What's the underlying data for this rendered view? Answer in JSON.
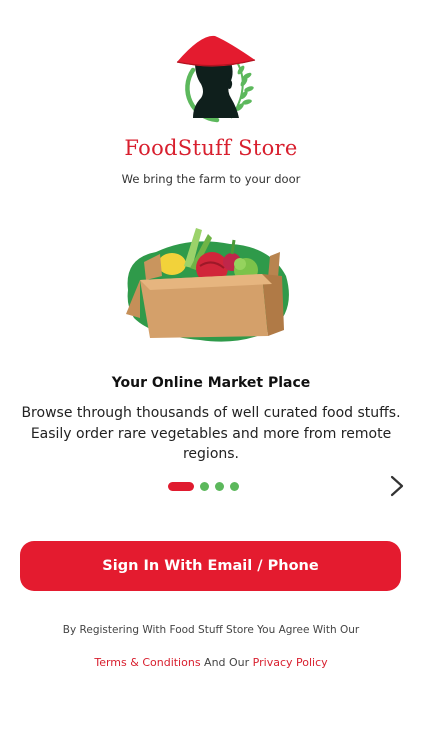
{
  "brand": {
    "name": "FoodStuff Store",
    "tagline": "We bring the farm to your door"
  },
  "slide": {
    "title": "Your Online Market Place",
    "description": "Browse through thousands of well curated food stuffs. Easily order rare vegetables and more from remote regions.",
    "current_index": 1,
    "total": 4
  },
  "actions": {
    "signin_label": "Sign In With Email / Phone"
  },
  "legal": {
    "notice": "By Registering With Food Stuff Store You Agree With Our",
    "terms_label": "Terms & Conditions",
    "connector": " And Our ",
    "privacy_label": "Privacy Policy"
  },
  "colors": {
    "accent_red": "#e41b2f",
    "accent_green": "#5cb85c"
  },
  "icons": {
    "next": "chevron-right-icon",
    "logo": "farmer-conical-hat-logo"
  }
}
